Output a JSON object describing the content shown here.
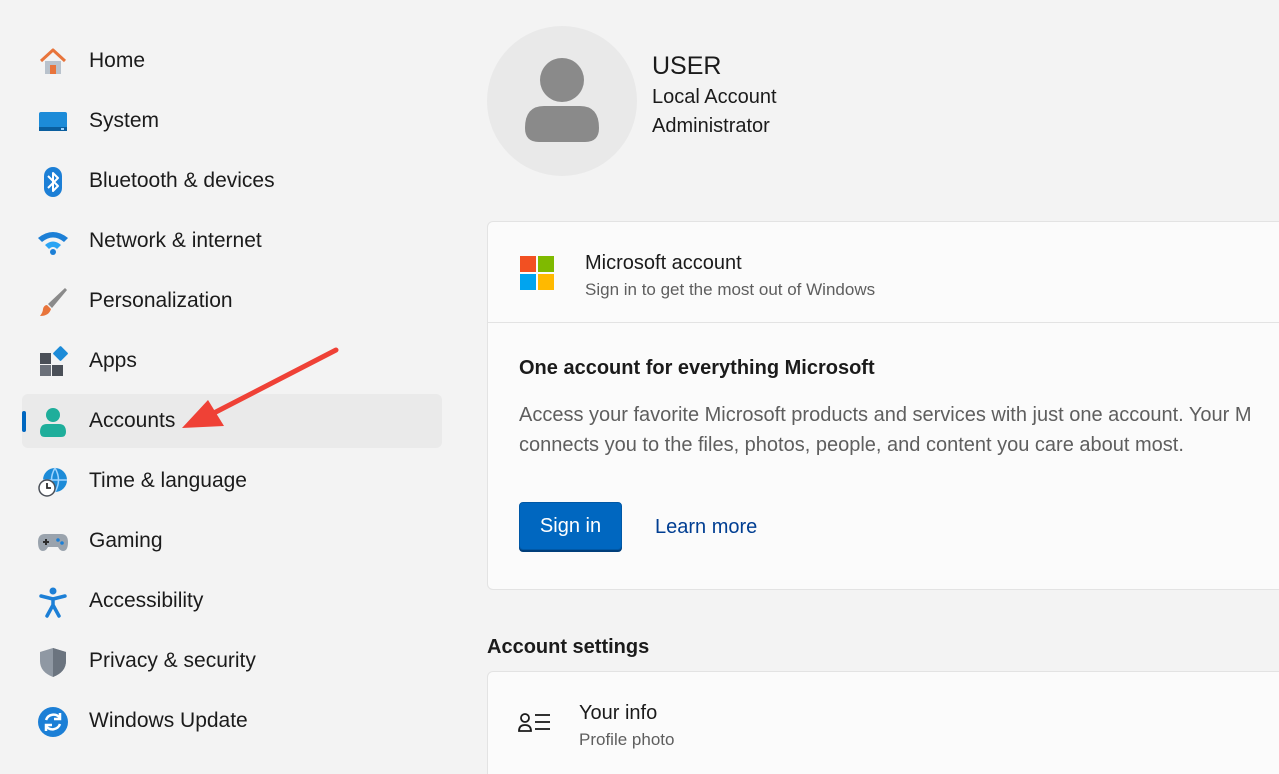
{
  "sidebar": {
    "items": [
      {
        "label": "Home",
        "icon": "home-icon"
      },
      {
        "label": "System",
        "icon": "system-icon"
      },
      {
        "label": "Bluetooth & devices",
        "icon": "bluetooth-icon"
      },
      {
        "label": "Network & internet",
        "icon": "wifi-icon"
      },
      {
        "label": "Personalization",
        "icon": "brush-icon"
      },
      {
        "label": "Apps",
        "icon": "apps-icon"
      },
      {
        "label": "Accounts",
        "icon": "person-icon",
        "active": true
      },
      {
        "label": "Time & language",
        "icon": "globe-clock-icon"
      },
      {
        "label": "Gaming",
        "icon": "gamepad-icon"
      },
      {
        "label": "Accessibility",
        "icon": "accessibility-icon"
      },
      {
        "label": "Privacy & security",
        "icon": "shield-icon"
      },
      {
        "label": "Windows Update",
        "icon": "update-icon"
      }
    ]
  },
  "profile": {
    "name": "USER",
    "account_type": "Local Account",
    "role": "Administrator"
  },
  "microsoft_account": {
    "title": "Microsoft account",
    "subtitle": "Sign in to get the most out of Windows",
    "heading": "One account for everything Microsoft",
    "body_line1": "Access your favorite Microsoft products and services with just one account. Your M",
    "body_line2": "connects you to the files, photos, people, and content you care about most.",
    "sign_in_label": "Sign in",
    "learn_more_label": "Learn more"
  },
  "account_settings": {
    "title": "Account settings",
    "your_info_title": "Your info",
    "your_info_subtitle": "Profile photo"
  },
  "colors": {
    "accent": "#0067c0",
    "background": "#f3f3f3",
    "card": "#fbfbfb",
    "annotation_arrow": "#ef4136"
  }
}
